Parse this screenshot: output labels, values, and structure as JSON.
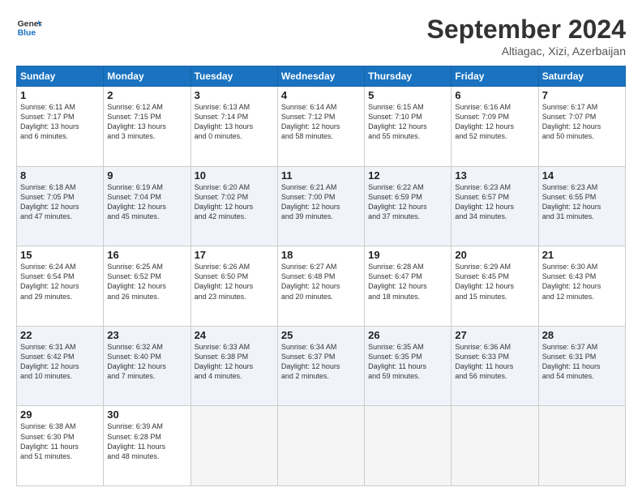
{
  "header": {
    "logo_line1": "General",
    "logo_line2": "Blue",
    "month": "September 2024",
    "location": "Altiagac, Xizi, Azerbaijan"
  },
  "weekdays": [
    "Sunday",
    "Monday",
    "Tuesday",
    "Wednesday",
    "Thursday",
    "Friday",
    "Saturday"
  ],
  "weeks": [
    [
      {
        "day": "1",
        "info": "Sunrise: 6:11 AM\nSunset: 7:17 PM\nDaylight: 13 hours\nand 6 minutes."
      },
      {
        "day": "2",
        "info": "Sunrise: 6:12 AM\nSunset: 7:15 PM\nDaylight: 13 hours\nand 3 minutes."
      },
      {
        "day": "3",
        "info": "Sunrise: 6:13 AM\nSunset: 7:14 PM\nDaylight: 13 hours\nand 0 minutes."
      },
      {
        "day": "4",
        "info": "Sunrise: 6:14 AM\nSunset: 7:12 PM\nDaylight: 12 hours\nand 58 minutes."
      },
      {
        "day": "5",
        "info": "Sunrise: 6:15 AM\nSunset: 7:10 PM\nDaylight: 12 hours\nand 55 minutes."
      },
      {
        "day": "6",
        "info": "Sunrise: 6:16 AM\nSunset: 7:09 PM\nDaylight: 12 hours\nand 52 minutes."
      },
      {
        "day": "7",
        "info": "Sunrise: 6:17 AM\nSunset: 7:07 PM\nDaylight: 12 hours\nand 50 minutes."
      }
    ],
    [
      {
        "day": "8",
        "info": "Sunrise: 6:18 AM\nSunset: 7:05 PM\nDaylight: 12 hours\nand 47 minutes."
      },
      {
        "day": "9",
        "info": "Sunrise: 6:19 AM\nSunset: 7:04 PM\nDaylight: 12 hours\nand 45 minutes."
      },
      {
        "day": "10",
        "info": "Sunrise: 6:20 AM\nSunset: 7:02 PM\nDaylight: 12 hours\nand 42 minutes."
      },
      {
        "day": "11",
        "info": "Sunrise: 6:21 AM\nSunset: 7:00 PM\nDaylight: 12 hours\nand 39 minutes."
      },
      {
        "day": "12",
        "info": "Sunrise: 6:22 AM\nSunset: 6:59 PM\nDaylight: 12 hours\nand 37 minutes."
      },
      {
        "day": "13",
        "info": "Sunrise: 6:23 AM\nSunset: 6:57 PM\nDaylight: 12 hours\nand 34 minutes."
      },
      {
        "day": "14",
        "info": "Sunrise: 6:23 AM\nSunset: 6:55 PM\nDaylight: 12 hours\nand 31 minutes."
      }
    ],
    [
      {
        "day": "15",
        "info": "Sunrise: 6:24 AM\nSunset: 6:54 PM\nDaylight: 12 hours\nand 29 minutes."
      },
      {
        "day": "16",
        "info": "Sunrise: 6:25 AM\nSunset: 6:52 PM\nDaylight: 12 hours\nand 26 minutes."
      },
      {
        "day": "17",
        "info": "Sunrise: 6:26 AM\nSunset: 6:50 PM\nDaylight: 12 hours\nand 23 minutes."
      },
      {
        "day": "18",
        "info": "Sunrise: 6:27 AM\nSunset: 6:48 PM\nDaylight: 12 hours\nand 20 minutes."
      },
      {
        "day": "19",
        "info": "Sunrise: 6:28 AM\nSunset: 6:47 PM\nDaylight: 12 hours\nand 18 minutes."
      },
      {
        "day": "20",
        "info": "Sunrise: 6:29 AM\nSunset: 6:45 PM\nDaylight: 12 hours\nand 15 minutes."
      },
      {
        "day": "21",
        "info": "Sunrise: 6:30 AM\nSunset: 6:43 PM\nDaylight: 12 hours\nand 12 minutes."
      }
    ],
    [
      {
        "day": "22",
        "info": "Sunrise: 6:31 AM\nSunset: 6:42 PM\nDaylight: 12 hours\nand 10 minutes."
      },
      {
        "day": "23",
        "info": "Sunrise: 6:32 AM\nSunset: 6:40 PM\nDaylight: 12 hours\nand 7 minutes."
      },
      {
        "day": "24",
        "info": "Sunrise: 6:33 AM\nSunset: 6:38 PM\nDaylight: 12 hours\nand 4 minutes."
      },
      {
        "day": "25",
        "info": "Sunrise: 6:34 AM\nSunset: 6:37 PM\nDaylight: 12 hours\nand 2 minutes."
      },
      {
        "day": "26",
        "info": "Sunrise: 6:35 AM\nSunset: 6:35 PM\nDaylight: 11 hours\nand 59 minutes."
      },
      {
        "day": "27",
        "info": "Sunrise: 6:36 AM\nSunset: 6:33 PM\nDaylight: 11 hours\nand 56 minutes."
      },
      {
        "day": "28",
        "info": "Sunrise: 6:37 AM\nSunset: 6:31 PM\nDaylight: 11 hours\nand 54 minutes."
      }
    ],
    [
      {
        "day": "29",
        "info": "Sunrise: 6:38 AM\nSunset: 6:30 PM\nDaylight: 11 hours\nand 51 minutes."
      },
      {
        "day": "30",
        "info": "Sunrise: 6:39 AM\nSunset: 6:28 PM\nDaylight: 11 hours\nand 48 minutes."
      },
      {
        "day": "",
        "info": ""
      },
      {
        "day": "",
        "info": ""
      },
      {
        "day": "",
        "info": ""
      },
      {
        "day": "",
        "info": ""
      },
      {
        "day": "",
        "info": ""
      }
    ]
  ]
}
